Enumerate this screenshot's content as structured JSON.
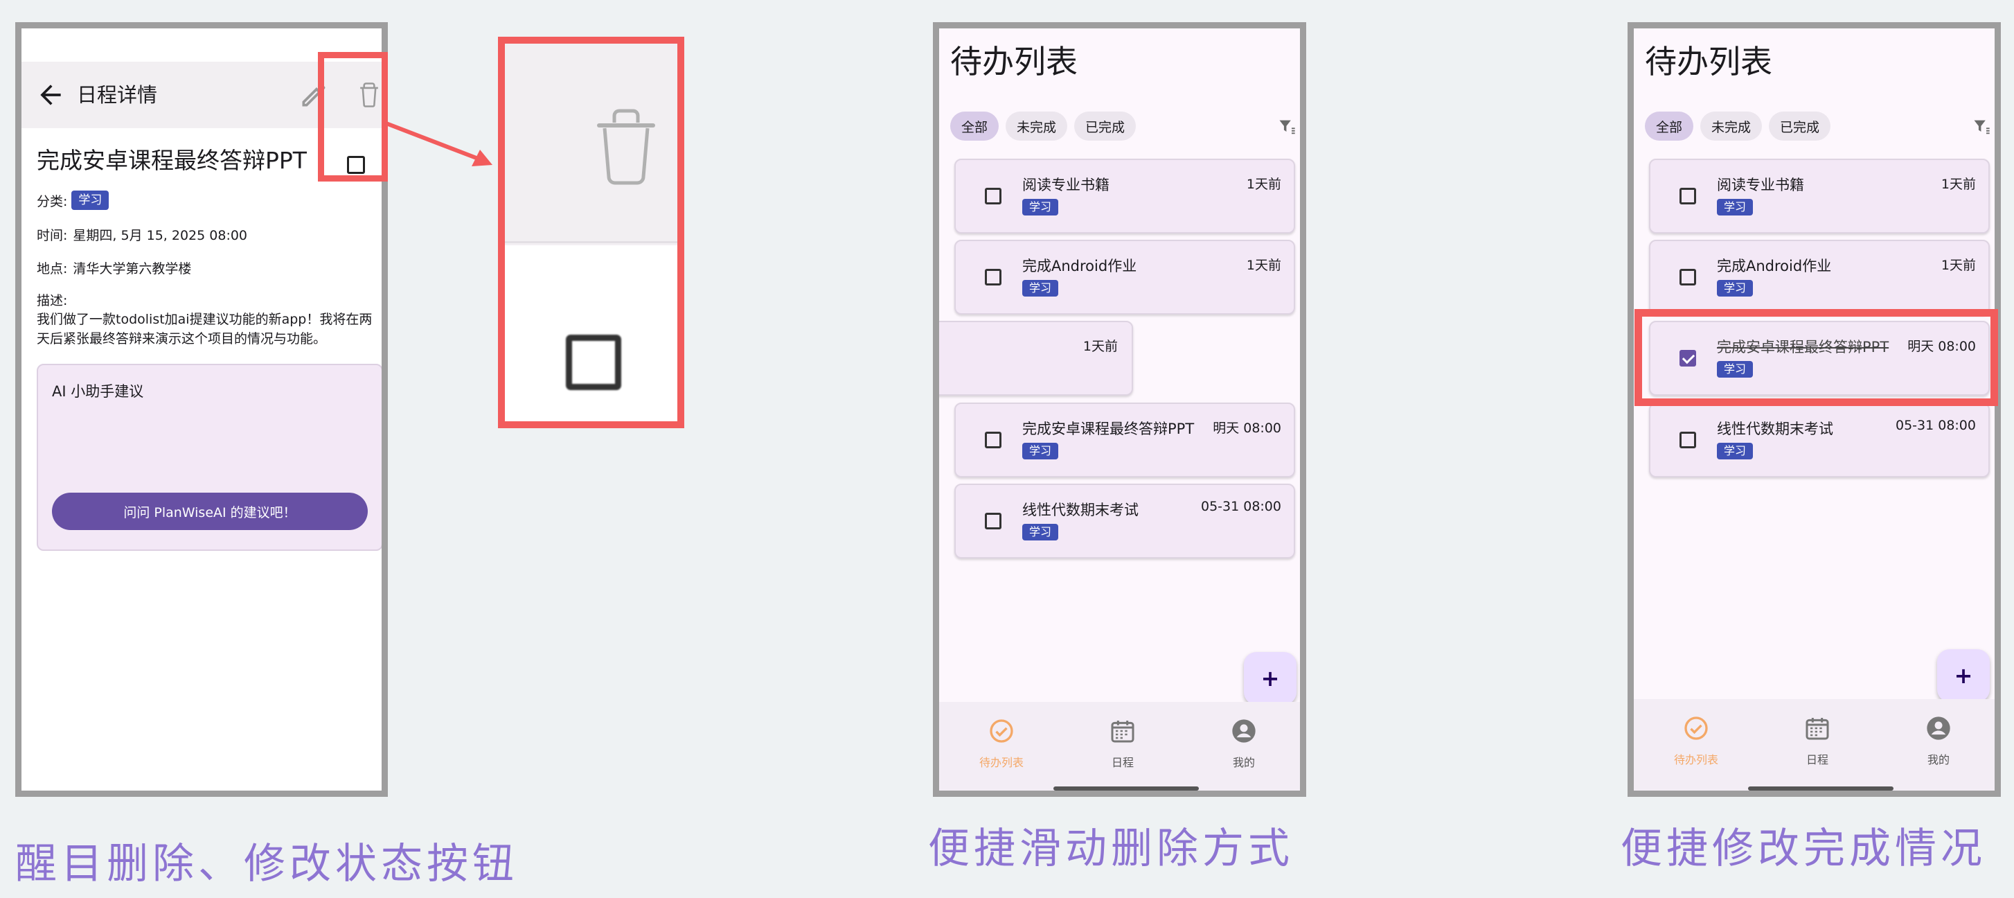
{
  "detail": {
    "title": "日程详情",
    "task_title": "完成安卓课程最终答辩PPT",
    "category_label": "分类:",
    "category": "学习",
    "time_label": "时间:",
    "time": "星期四, 5月 15, 2025 08:00",
    "location_label": "地点:",
    "location": "清华大学第六教学楼",
    "desc_label": "描述:",
    "desc": "我们做了一款todolist加ai提建议功能的新app！我将在两天后紧张最终答辩来演示这个项目的情况与功能。",
    "ai_title": "AI 小助手建议",
    "ai_button": "问问 PlanWiseAI 的建议吧！",
    "highlight_color": "#f25c5c"
  },
  "todo_title": "待办列表",
  "tabs": [
    "全部",
    "未完成",
    "已完成"
  ],
  "nav": [
    "待办列表",
    "日程",
    "我的"
  ],
  "fab_label": "+",
  "list2": [
    {
      "title": "阅读专业书籍",
      "tag": "学习",
      "time": "1天前",
      "done": false
    },
    {
      "title": "完成Android作业",
      "tag": "学习",
      "time": "1天前",
      "done": false
    },
    {
      "title": "",
      "tag": "",
      "time": "1天前",
      "done": false
    },
    {
      "title": "完成安卓课程最终答辩PPT",
      "tag": "学习",
      "time": "明天 08:00",
      "done": false
    },
    {
      "title": "线性代数期末考试",
      "tag": "学习",
      "time": "05-31 08:00",
      "done": false
    }
  ],
  "list3": [
    {
      "title": "阅读专业书籍",
      "tag": "学习",
      "time": "1天前",
      "done": false
    },
    {
      "title": "完成Android作业",
      "tag": "学习",
      "time": "1天前",
      "done": false
    },
    {
      "title": "完成安卓课程最终答辩PPT",
      "tag": "学习",
      "time": "明天 08:00",
      "done": true
    },
    {
      "title": "线性代数期末考试",
      "tag": "学习",
      "time": "05-31 08:00",
      "done": false
    }
  ],
  "captions": [
    "醒目删除、修改状态按钮",
    "便捷滑动删除方式",
    "便捷修改完成情况"
  ],
  "colors": {
    "accent": "#6750a4",
    "chip": "#3f51b5",
    "nav_active": "#f4a867",
    "caption": "#8d74d2"
  }
}
